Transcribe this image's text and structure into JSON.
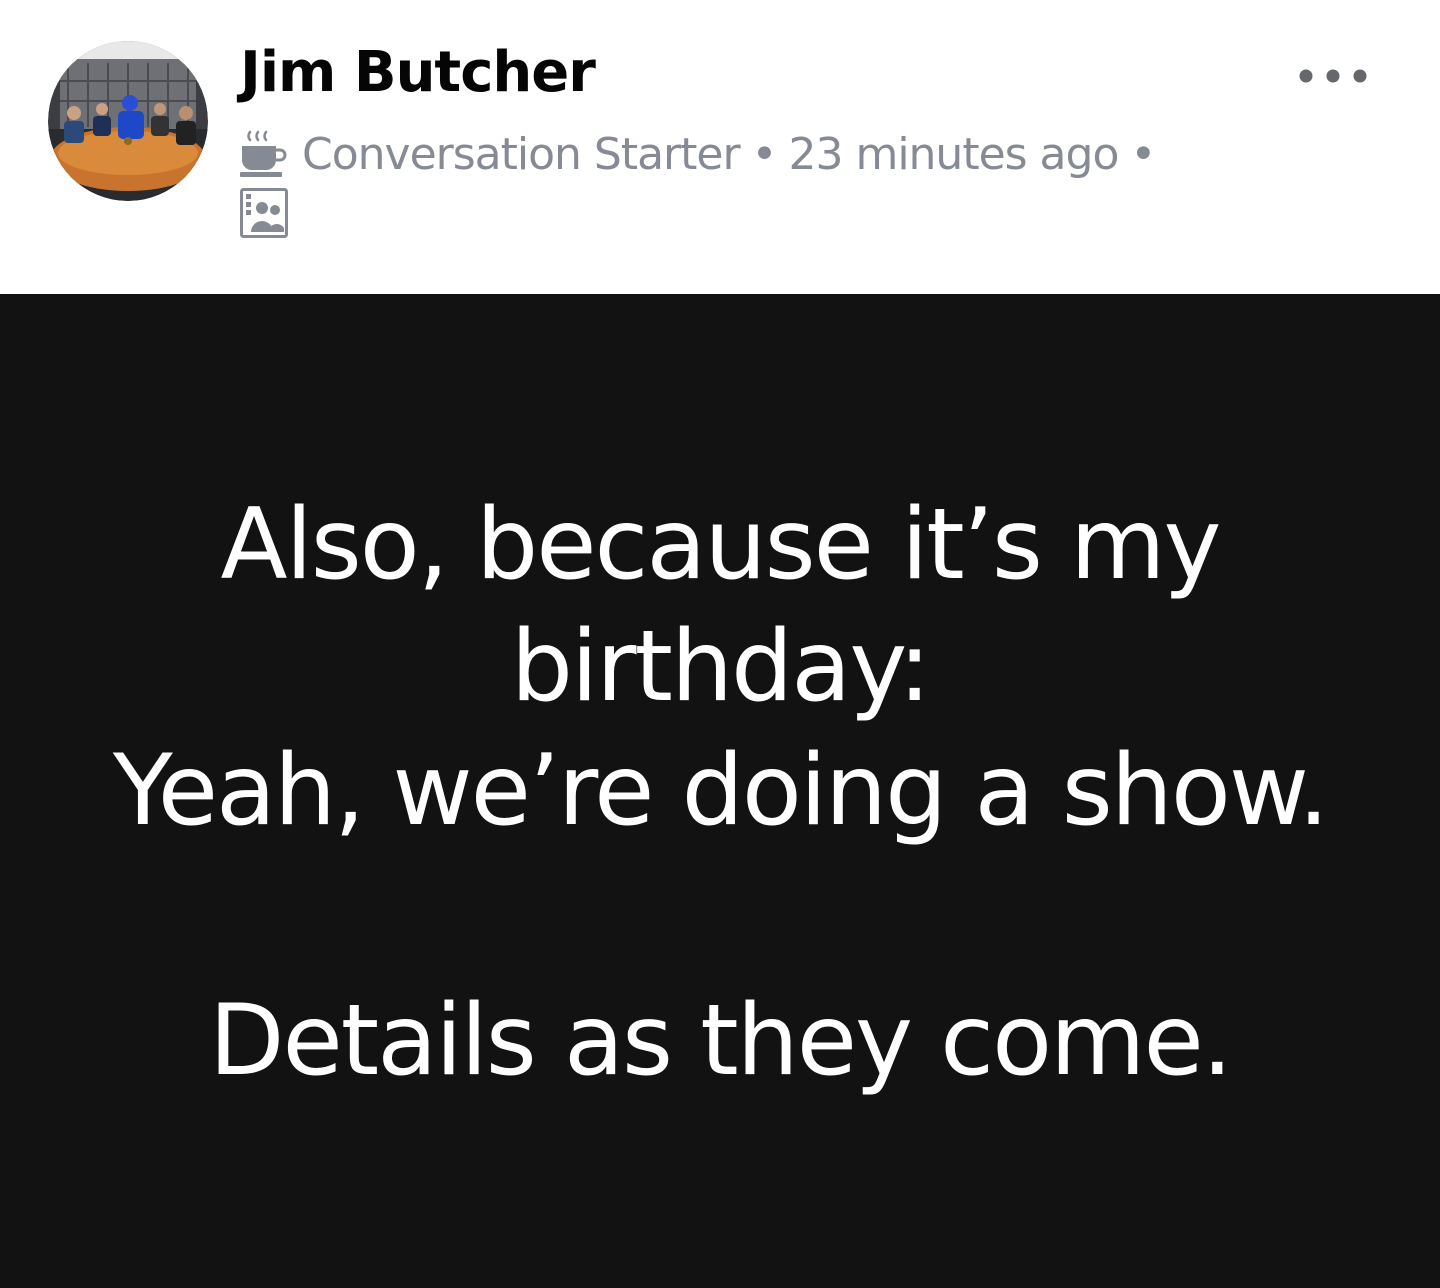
{
  "post": {
    "author_name": "Jim Butcher",
    "badge_label": "Conversation Starter",
    "separator": "•",
    "timestamp": "23 minutes ago",
    "badge_icon": "coffee-cup-icon",
    "audience_icon": "group-audience-icon",
    "more_icon": "more-options-icon",
    "content_lines": [
      "Also, because it’s my",
      "birthday:",
      "Yeah, we’re doing a show.",
      "Details as they come."
    ],
    "background_color": "#121212",
    "text_color": "#ffffff"
  }
}
